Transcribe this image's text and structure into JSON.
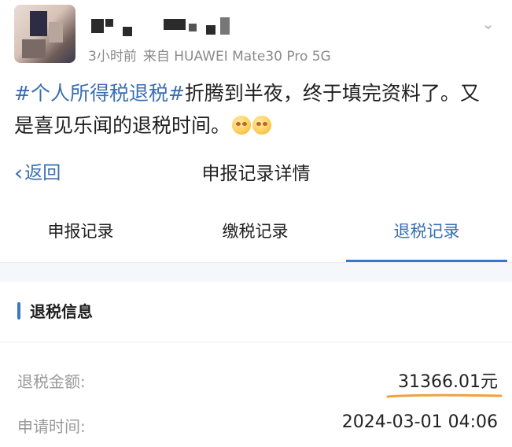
{
  "post": {
    "meta_time": "3小时前",
    "meta_from": "来自 HUAWEI Mate30 Pro 5G",
    "hashtag": "#个人所得税退税#",
    "text": "折腾到半夜，终于填完资料了。又是喜见乐闻的退税时间。",
    "emoji_names": [
      "emoji-icon",
      "emoji-icon"
    ]
  },
  "nav": {
    "back_label": "返回",
    "title": "申报记录详情"
  },
  "tabs": [
    {
      "label": "申报记录",
      "active": false
    },
    {
      "label": "缴税记录",
      "active": false
    },
    {
      "label": "退税记录",
      "active": true
    }
  ],
  "section": {
    "title": "退税信息"
  },
  "rows": [
    {
      "label": "退税金额:",
      "value": "31366.01元"
    },
    {
      "label": "申请时间:",
      "value": "2024-03-01 04:06"
    }
  ],
  "colors": {
    "accent": "#3a76c9",
    "link": "#3a6fb3",
    "highlight_underline": "#f0a13c"
  }
}
